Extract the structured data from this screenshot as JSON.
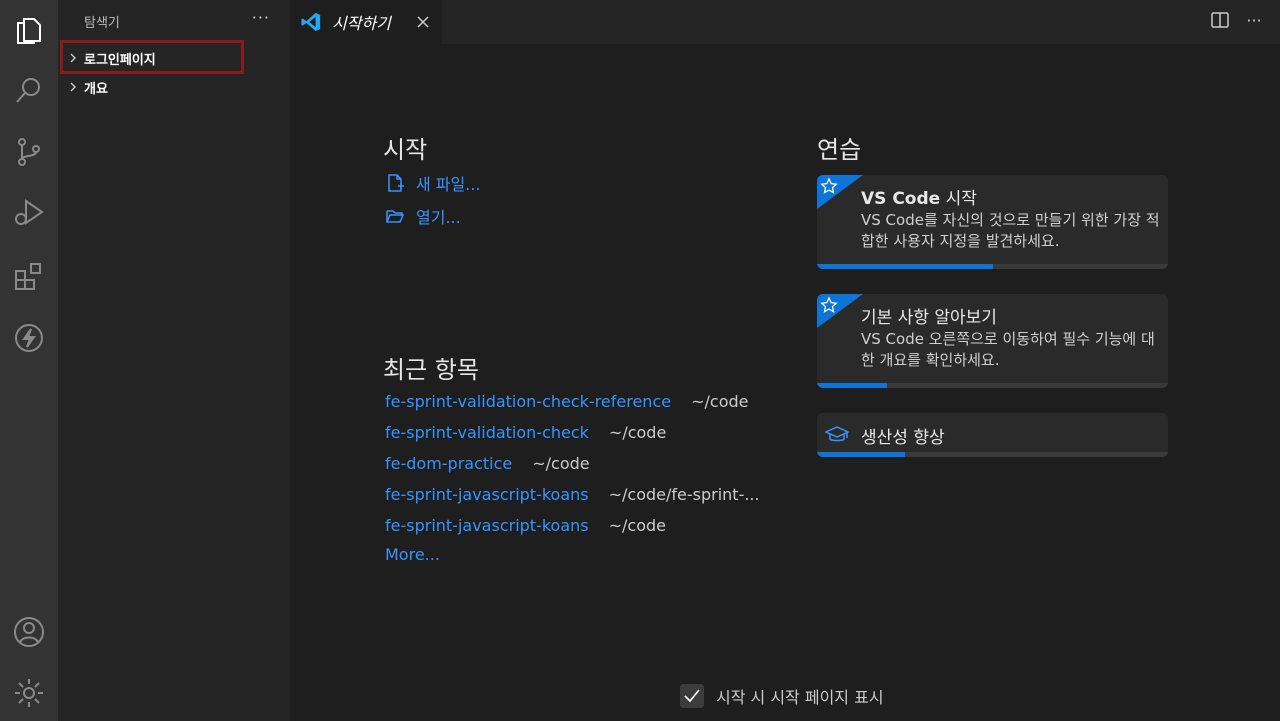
{
  "sidebar": {
    "title": "탐색기",
    "more": "···",
    "items": [
      {
        "label": "로그인페이지"
      },
      {
        "label": "개요"
      }
    ]
  },
  "tab": {
    "label": "시작하기",
    "close": "close"
  },
  "start": {
    "heading": "시작",
    "new_file": "새 파일...",
    "open": "열기..."
  },
  "recent": {
    "heading": "최근 항목",
    "items": [
      {
        "name": "fe-sprint-validation-check-reference",
        "path": "~/code"
      },
      {
        "name": "fe-sprint-validation-check",
        "path": "~/code"
      },
      {
        "name": "fe-dom-practice",
        "path": "~/code"
      },
      {
        "name": "fe-sprint-javascript-koans",
        "path": "~/code/fe-sprint-..."
      },
      {
        "name": "fe-sprint-javascript-koans",
        "path": "~/code"
      }
    ],
    "more": "More..."
  },
  "walkthroughs": {
    "heading": "연습",
    "cards": [
      {
        "title_bold": "VS Code",
        "title_rest": " 시작",
        "desc": "VS Code를 자신의 것으로 만들기 위한 가장 적합한 사용자 지정을 발견하세요.",
        "progress": 0.5
      },
      {
        "title": "기본 사항 알아보기",
        "desc": "VS Code 오른쪽으로 이동하여 필수 기능에 대한 개요를 확인하세요.",
        "progress": 0.2
      },
      {
        "title": "생산성 향상",
        "progress": 0.25
      }
    ]
  },
  "footer": {
    "checkbox_label": "시작 시 시작 페이지 표시",
    "checked": true
  },
  "colors": {
    "accent": "#3794ff",
    "progress": "#0e75d8",
    "highlight": "#8b1a1a"
  }
}
